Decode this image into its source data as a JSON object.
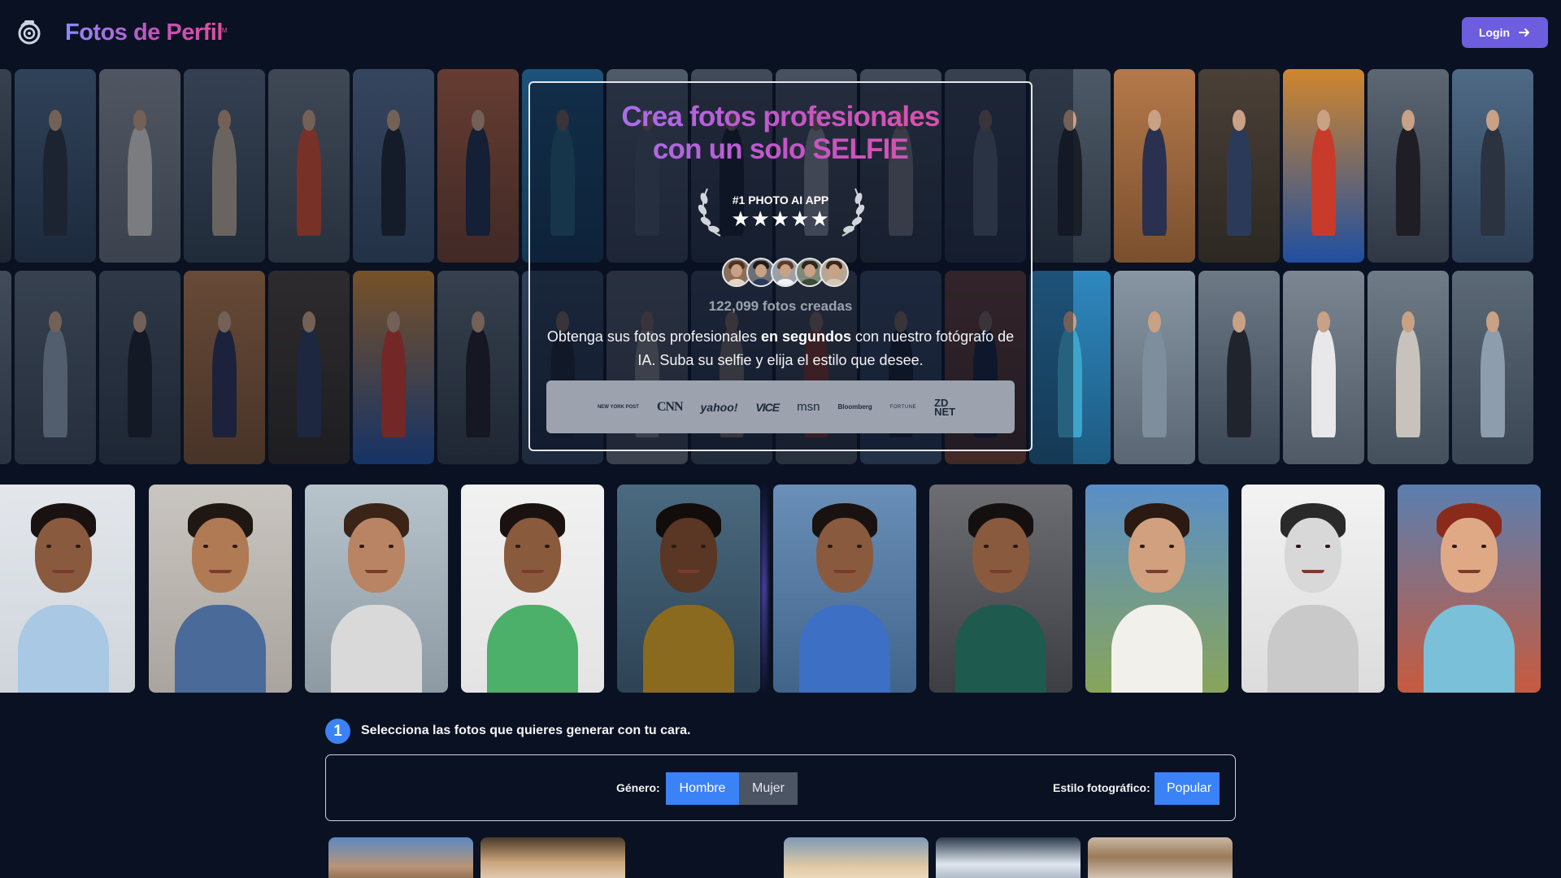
{
  "header": {
    "brand": "Fotos de Perfil",
    "trademark": "TM",
    "login_label": "Login"
  },
  "hero": {
    "title_line1": "Crea fotos profesionales",
    "title_line2": "con un solo SELFIE",
    "award": "#1 PHOTO AI APP",
    "rating_stars": 5,
    "stars_text": "★★★★★",
    "photos_count": "122,099 fotos creadas",
    "desc_part1": "Obtenga sus fotos profesionales ",
    "desc_bold": "en segundos",
    "desc_part2": " con nuestro fotógrafo de IA. Suba su selfie y elija el estilo que desee.",
    "press": [
      "NEW YORK POST",
      "CNN",
      "yahoo!",
      "VICE",
      "msn",
      "Bloomberg",
      "FORTUNE",
      "ZD NET"
    ]
  },
  "step": {
    "number": "1",
    "text": "Selecciona las fotos que quieres generar con tu cara."
  },
  "filters": {
    "gender_label": "Género:",
    "gender_options": [
      "Hombre",
      "Mujer"
    ],
    "gender_selected": "Hombre",
    "style_label": "Estilo fotográfico:",
    "style_selected": "Popular"
  },
  "colors": {
    "background": "#0a1122",
    "accent": "#3b82f6",
    "login": "#6d5ddf",
    "brand_gradient_start": "#8b8bff",
    "brand_gradient_end": "#e04fa0"
  },
  "icons": [
    "camera-lens-logo-icon",
    "arrow-right-icon",
    "laurel-left-icon",
    "laurel-right-icon",
    "star-icon"
  ]
}
